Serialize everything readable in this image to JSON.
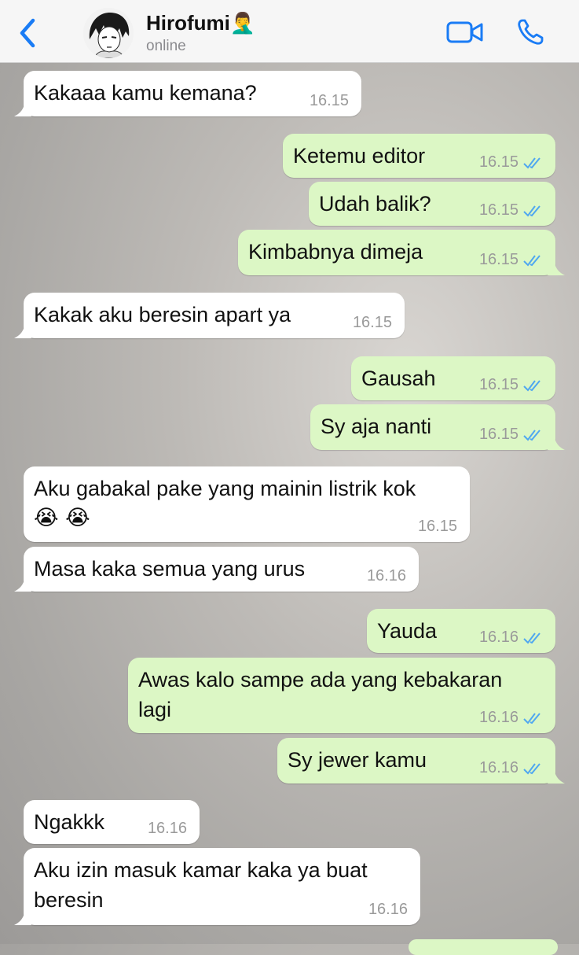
{
  "header": {
    "contact_name": "Hirofumi",
    "contact_emoji": "🤦‍♂️",
    "status": "online"
  },
  "messages": [
    {
      "dir": "in",
      "text": "Kakaaa kamu kemana?",
      "time": "16.15"
    },
    {
      "dir": "out",
      "text": "Ketemu editor",
      "time": "16.15"
    },
    {
      "dir": "out",
      "text": "Udah balik?",
      "time": "16.15"
    },
    {
      "dir": "out",
      "text": "Kimbabnya dimeja",
      "time": "16.15"
    },
    {
      "dir": "in",
      "text": "Kakak aku beresin apart ya",
      "time": "16.15"
    },
    {
      "dir": "out",
      "text": "Gausah",
      "time": "16.15"
    },
    {
      "dir": "out",
      "text": "Sy aja nanti",
      "time": "16.15"
    },
    {
      "dir": "in",
      "text": "Aku gabakal pake yang mainin listrik kok",
      "text2": "😭 😭",
      "time": "16.15"
    },
    {
      "dir": "in",
      "text": "Masa kaka semua yang urus",
      "time": "16.16"
    },
    {
      "dir": "out",
      "text": "Yauda",
      "time": "16.16"
    },
    {
      "dir": "out",
      "text": "Awas kalo sampe ada yang kebakaran",
      "text2": "lagi",
      "time": "16.16"
    },
    {
      "dir": "out",
      "text": "Sy jewer kamu",
      "time": "16.16"
    },
    {
      "dir": "in",
      "text": "Ngakkk",
      "time": "16.16"
    },
    {
      "dir": "in",
      "text": "Aku izin masuk kamar kaka ya buat",
      "text2": "beresin",
      "time": "16.16"
    }
  ],
  "colors": {
    "incoming": "#ffffff",
    "outgoing": "#dcf7c5",
    "accent": "#1a7cf5",
    "tick": "#4fa7f0"
  },
  "icons": {
    "back": "chevron-left-icon",
    "video": "video-camera-icon",
    "phone": "phone-icon",
    "read": "double-check-icon"
  }
}
